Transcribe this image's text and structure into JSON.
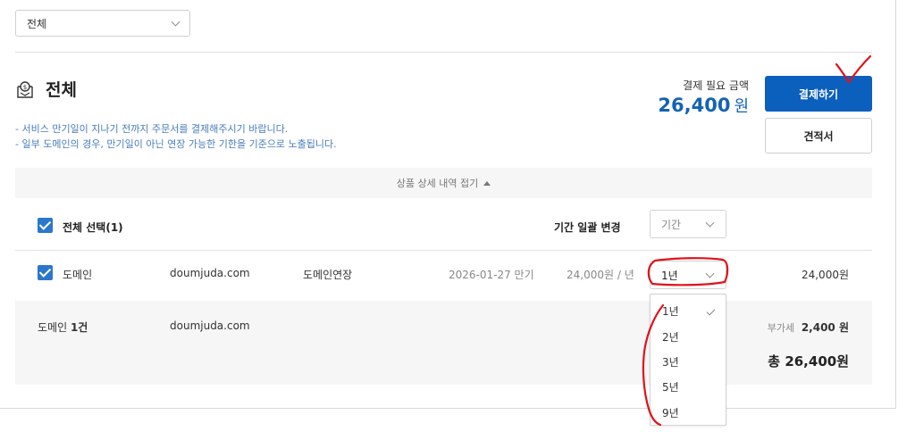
{
  "filter": {
    "selected": "전체"
  },
  "section": {
    "title": "전체",
    "icon": "money-box-icon"
  },
  "notes": [
    "- 서비스 만기일이 지나기 전까지 주문서를 결제해주시기 바랍니다.",
    "- 일부 도메인의 경우, 만기일이 아닌 연장 가능한 기한을 기준으로 노출됩니다."
  ],
  "payment": {
    "label": "결제 필요 금액",
    "amount": "26,400",
    "unit": "원"
  },
  "buttons": {
    "pay": "결제하기",
    "quote": "견적서"
  },
  "details": {
    "collapse_label": "상품 상세 내역 접기",
    "select_all": "전체 선택(1)",
    "bulk_period_label": "기간 일괄 변경",
    "bulk_period_placeholder": "기간",
    "item": {
      "type": "도메인",
      "domain": "doumjuda.com",
      "service": "도메인연장",
      "expiry": "2026-01-27 만기",
      "unit_price": "24,000원 / 년",
      "period": "1년",
      "price": "24,000원"
    },
    "summary": {
      "count_prefix": "도메인",
      "count": "1건",
      "domain": "doumjuda.com",
      "vat_label": "부가세",
      "vat": "2,400 원",
      "total_prefix": "총",
      "total": "26,400원"
    }
  },
  "dropdown": {
    "options": [
      "1년",
      "2년",
      "3년",
      "5년",
      "9년"
    ],
    "selected": "1년"
  },
  "colors": {
    "primary": "#0b5fbd",
    "amount": "#1463b4",
    "note": "#4a7bbd",
    "checkbox": "#2b77cc",
    "annotation": "#e0121b"
  }
}
